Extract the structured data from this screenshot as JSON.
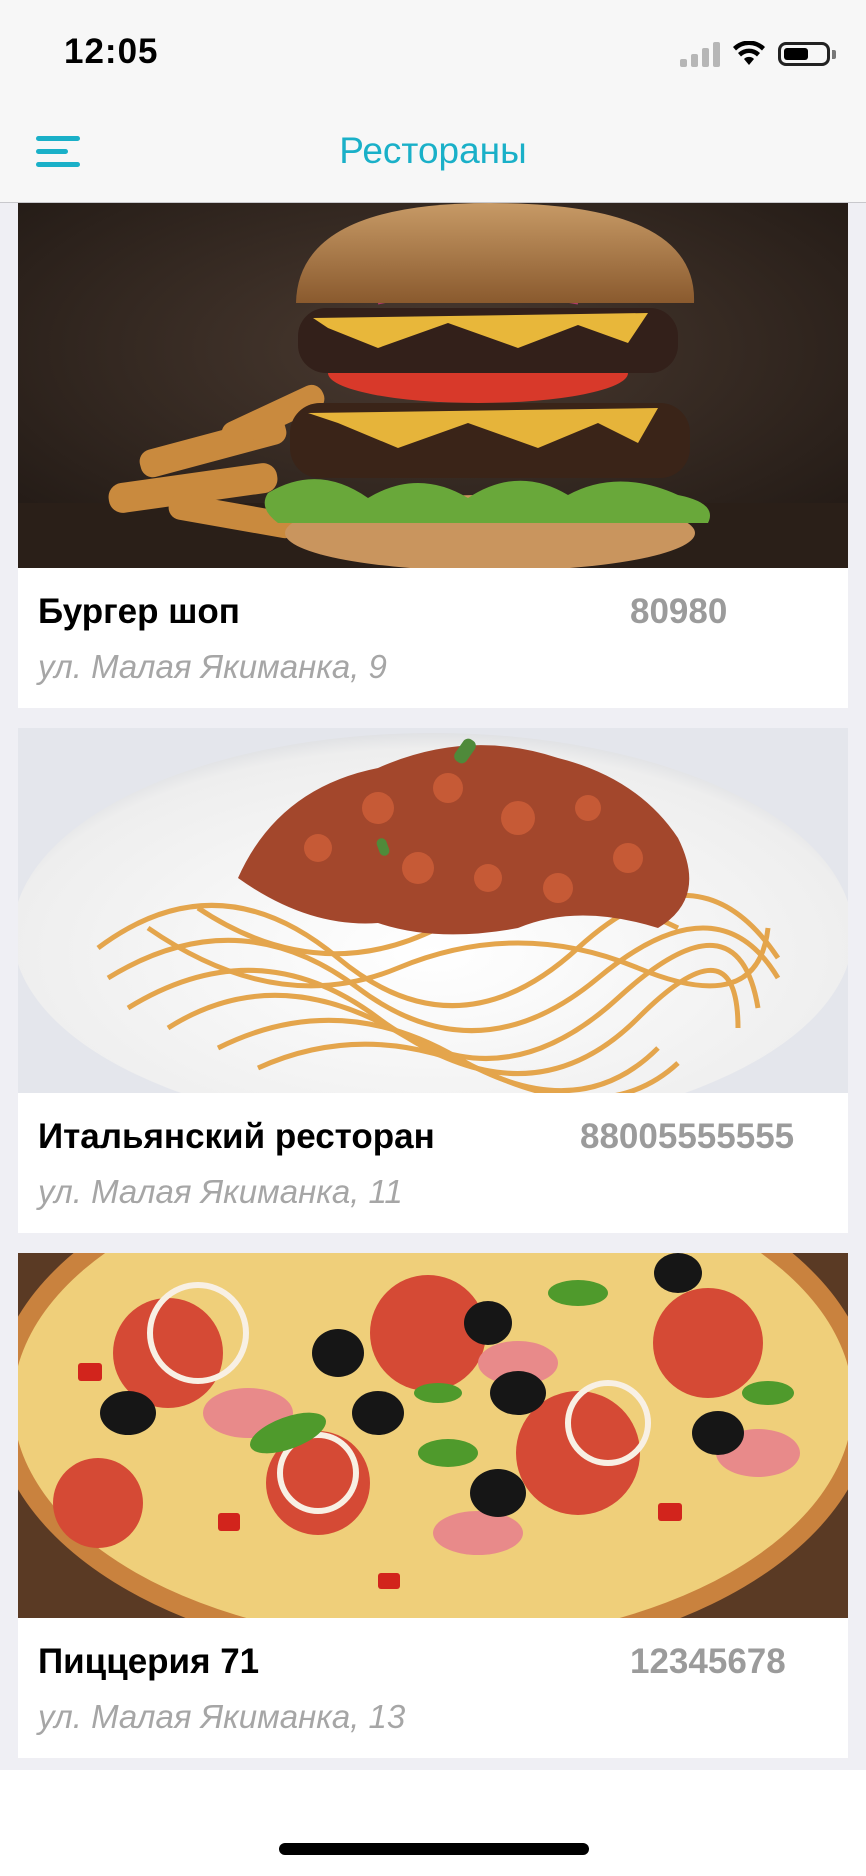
{
  "status_bar": {
    "time": "12:05"
  },
  "nav": {
    "title": "Рестораны",
    "menu_icon": "hamburger-menu-icon"
  },
  "restaurants": [
    {
      "name": "Бургер шоп",
      "phone": "80980",
      "address": "ул. Малая Якиманка, 9",
      "image": "burger-photo"
    },
    {
      "name": "Итальянский ресторан",
      "phone": "88005555555",
      "address": "ул. Малая Якиманка, 11",
      "image": "pasta-photo"
    },
    {
      "name": "Пиццерия 71",
      "phone": "12345678",
      "address": "ул. Малая Якиманка, 13",
      "image": "pizza-photo"
    }
  ],
  "colors": {
    "accent": "#1ab0c8",
    "phone_text": "#9b9b9b",
    "address_text": "#a6a6a6"
  }
}
